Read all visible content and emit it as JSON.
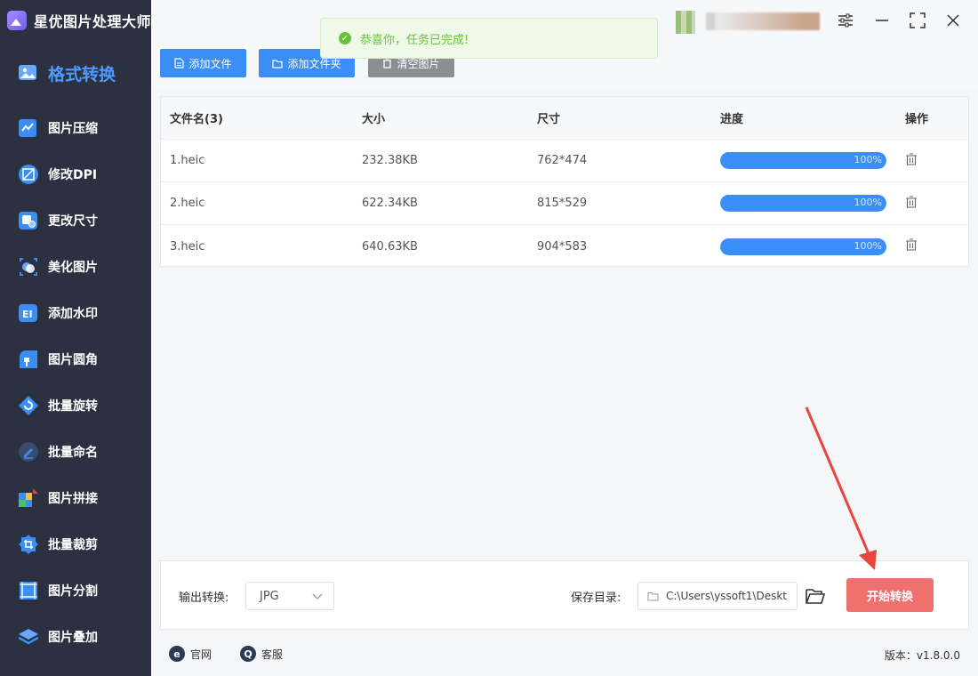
{
  "app": {
    "title": "星优图片处理大师"
  },
  "sidebar": {
    "active": {
      "label": "格式转换",
      "icon": "image-convert-icon"
    },
    "items": [
      {
        "label": "图片压缩",
        "icon": "compress-icon"
      },
      {
        "label": "修改DPI",
        "icon": "dpi-icon"
      },
      {
        "label": "更改尺寸",
        "icon": "resize-icon"
      },
      {
        "label": "美化图片",
        "icon": "beautify-icon"
      },
      {
        "label": "添加水印",
        "icon": "watermark-icon"
      },
      {
        "label": "图片圆角",
        "icon": "round-corner-icon"
      },
      {
        "label": "批量旋转",
        "icon": "rotate-icon"
      },
      {
        "label": "批量命名",
        "icon": "rename-icon"
      },
      {
        "label": "图片拼接",
        "icon": "puzzle-icon"
      },
      {
        "label": "批量裁剪",
        "icon": "crop-icon"
      },
      {
        "label": "图片分割",
        "icon": "split-icon"
      },
      {
        "label": "图片叠加",
        "icon": "layers-icon"
      }
    ]
  },
  "toolbar": {
    "add_file": "添加文件",
    "add_folder": "添加文件夹",
    "clear": "清空图片"
  },
  "toast": {
    "message": "恭喜你，任务已完成!"
  },
  "table": {
    "headers": [
      "文件名(3)",
      "大小",
      "尺寸",
      "进度",
      "操作"
    ],
    "rows": [
      {
        "name": "1.heic",
        "size": "232.38KB",
        "dims": "762*474",
        "progress": "100%",
        "progress_value": 1.0
      },
      {
        "name": "2.heic",
        "size": "622.34KB",
        "dims": "815*529",
        "progress": "100%",
        "progress_value": 1.0
      },
      {
        "name": "3.heic",
        "size": "640.63KB",
        "dims": "904*583",
        "progress": "100%",
        "progress_value": 1.0
      }
    ]
  },
  "bottom": {
    "output_label": "输出转换:",
    "format": "JPG",
    "save_label": "保存目录:",
    "save_path": "C:\\Users\\yssoft1\\Deskt",
    "start_button": "开始转换"
  },
  "status": {
    "website": "官网",
    "support": "客服",
    "version": "版本：v1.8.0.0"
  },
  "colors": {
    "sidebar_bg": "#2b3141",
    "accent_blue": "#3a8ef6",
    "start_button": "#f07070",
    "toast_text": "#67c23a",
    "annotation_arrow": "#e8453c"
  }
}
